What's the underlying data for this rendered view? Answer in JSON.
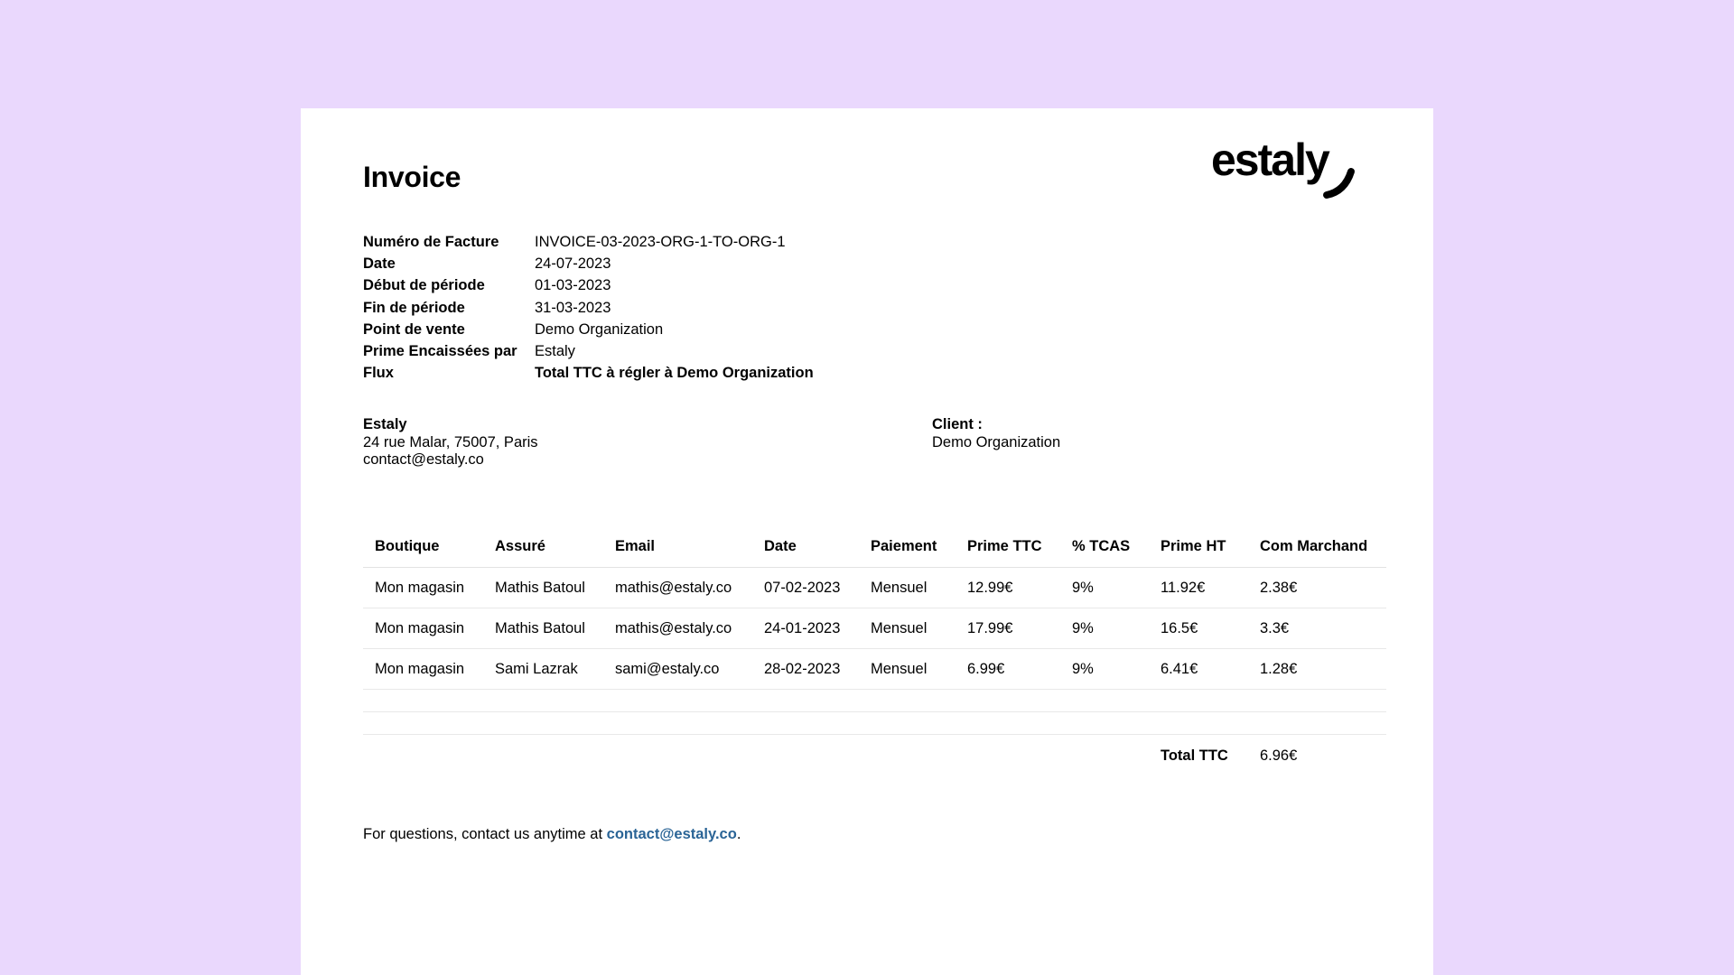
{
  "invoice": {
    "title": "Invoice",
    "brand": "estaly",
    "meta": [
      {
        "label": "Numéro de Facture",
        "value": "INVOICE-03-2023-ORG-1-TO-ORG-1"
      },
      {
        "label": "Date",
        "value": "24-07-2023"
      },
      {
        "label": "Début de période",
        "value": "01-03-2023"
      },
      {
        "label": "Fin de période",
        "value": "31-03-2023"
      },
      {
        "label": "Point de vente",
        "value": "Demo Organization"
      },
      {
        "label": "Prime Encaissées par",
        "value": "Estaly"
      },
      {
        "label": "Flux",
        "value": "Total TTC à régler à Demo Organization"
      }
    ],
    "seller": {
      "name": "Estaly",
      "address": "24 rue Malar, 75007, Paris",
      "email": "contact@estaly.co"
    },
    "client": {
      "label": "Client :",
      "name": "Demo Organization"
    },
    "table": {
      "headers": [
        "Boutique",
        "Assuré",
        "Email",
        "Date",
        "Paiement",
        "Prime TTC",
        "% TCAS",
        "Prime HT",
        "Com Marchand"
      ],
      "rows": [
        [
          "Mon magasin",
          "Mathis Batoul",
          "mathis@estaly.co",
          "07-02-2023",
          "Mensuel",
          "12.99€",
          "9%",
          "11.92€",
          "2.38€"
        ],
        [
          "Mon magasin",
          "Mathis Batoul",
          "mathis@estaly.co",
          "24-01-2023",
          "Mensuel",
          "17.99€",
          "9%",
          "16.5€",
          "3.3€"
        ],
        [
          "Mon magasin",
          "Sami Lazrak",
          "sami@estaly.co",
          "28-02-2023",
          "Mensuel",
          "6.99€",
          "9%",
          "6.41€",
          "1.28€"
        ]
      ],
      "total_label": "Total TTC",
      "total_value": "6.96€"
    },
    "footer": {
      "text": "For questions, contact us anytime at ",
      "link": "contact@estaly.co",
      "suffix": "."
    }
  }
}
